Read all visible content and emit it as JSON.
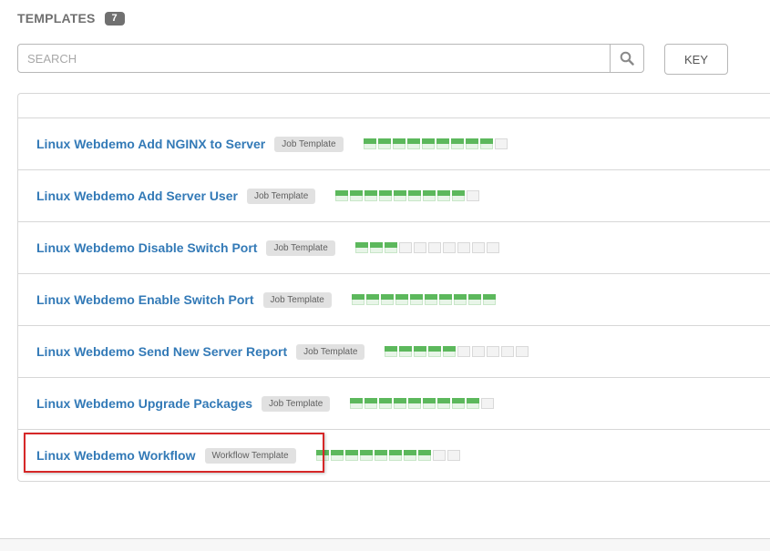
{
  "header": {
    "title": "TEMPLATES",
    "count": "7"
  },
  "search": {
    "placeholder": "SEARCH",
    "value": ""
  },
  "key_button": {
    "label": "KEY"
  },
  "colors": {
    "success": "#5cb85c",
    "link": "#337ab7",
    "highlight": "#d62728"
  },
  "templates": [
    {
      "name": "Linux Webdemo Add NGINX to Server",
      "type": "Job Template",
      "jobs": [
        1,
        1,
        1,
        1,
        1,
        1,
        1,
        1,
        1,
        0
      ]
    },
    {
      "name": "Linux Webdemo Add Server User",
      "type": "Job Template",
      "jobs": [
        1,
        1,
        1,
        1,
        1,
        1,
        1,
        1,
        1,
        0
      ]
    },
    {
      "name": "Linux Webdemo Disable Switch Port",
      "type": "Job Template",
      "jobs": [
        1,
        1,
        1,
        0,
        0,
        0,
        0,
        0,
        0,
        0
      ]
    },
    {
      "name": "Linux Webdemo Enable Switch Port",
      "type": "Job Template",
      "jobs": [
        1,
        1,
        1,
        1,
        1,
        1,
        1,
        1,
        1,
        1
      ]
    },
    {
      "name": "Linux Webdemo Send New Server Report",
      "type": "Job Template",
      "jobs": [
        1,
        1,
        1,
        1,
        1,
        0,
        0,
        0,
        0,
        0
      ]
    },
    {
      "name": "Linux Webdemo Upgrade Packages",
      "type": "Job Template",
      "jobs": [
        1,
        1,
        1,
        1,
        1,
        1,
        1,
        1,
        1,
        0
      ]
    },
    {
      "name": "Linux Webdemo Workflow",
      "type": "Workflow Template",
      "jobs": [
        1,
        1,
        1,
        1,
        1,
        1,
        1,
        1,
        0,
        0
      ]
    }
  ]
}
